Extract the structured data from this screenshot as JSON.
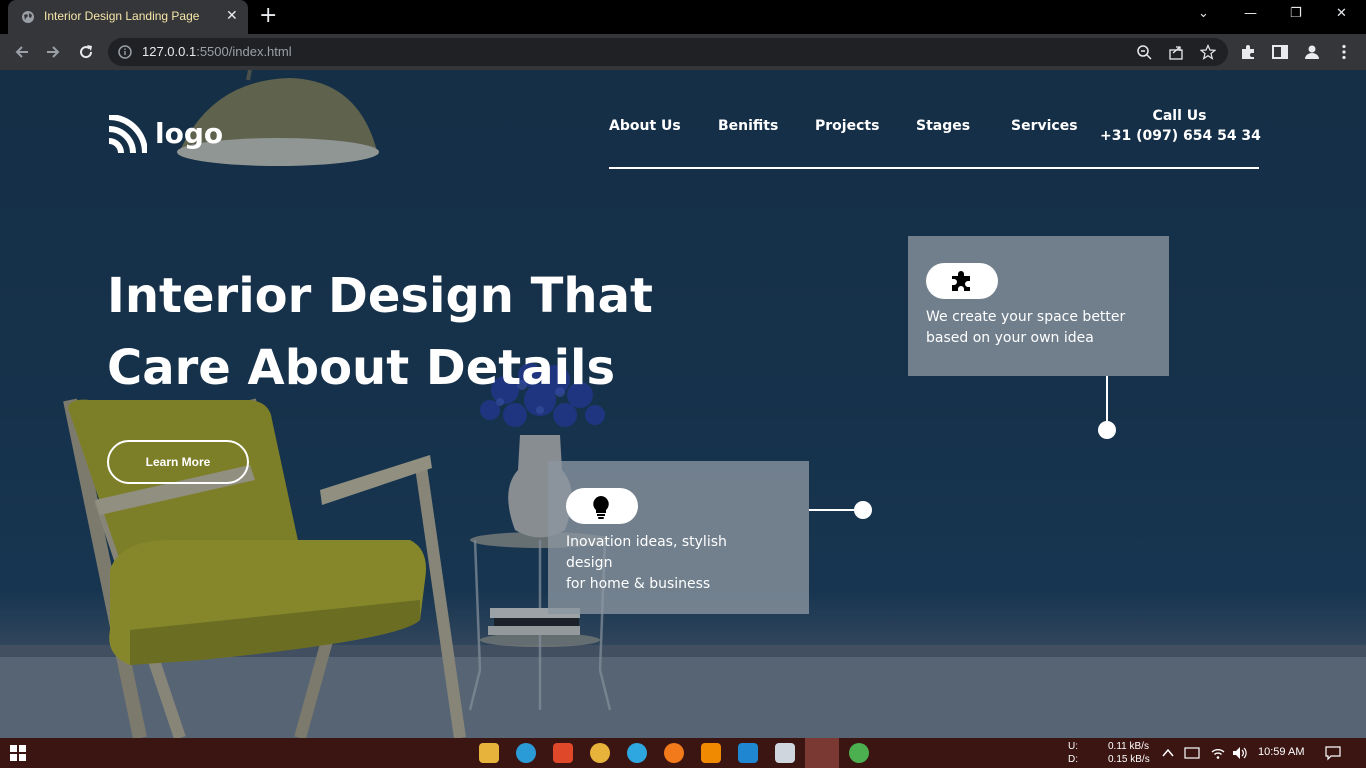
{
  "browser": {
    "tab_title": "Interior Design Landing Page",
    "tab_close": "✕",
    "new_tab": "+",
    "url_host": "127.0.0.1",
    "url_rest": ":5500/index.html",
    "window_min": "—",
    "window_restore": "❐",
    "window_close": "✕",
    "window_dropdown": "⌄"
  },
  "site": {
    "logo_text": "logo",
    "nav": [
      "About Us",
      "Benifits",
      "Projects",
      "Stages",
      "Services"
    ],
    "call_label": "Call Us",
    "call_number": "+31 (097) 654 54 34",
    "headline_line1": "Interior Design That",
    "headline_line2": "Care About Details",
    "cta_label": "Learn More",
    "card_top_text": "We create your space better\nbased on your own idea",
    "card_bottom_text": "Inovation ideas, stylish\ndesign\nfor home & business"
  },
  "taskbar": {
    "net_up_label": "U:",
    "net_down_label": "D:",
    "net_up": "0.11 kB/s",
    "net_down": "0.15 kB/s",
    "time": "10:59 AM"
  },
  "colors": {
    "hero_bg": "#1c3a57",
    "card_bg": "#8c96a0",
    "taskbar": "#3a1512",
    "tab_title": "#f5e6a8"
  }
}
